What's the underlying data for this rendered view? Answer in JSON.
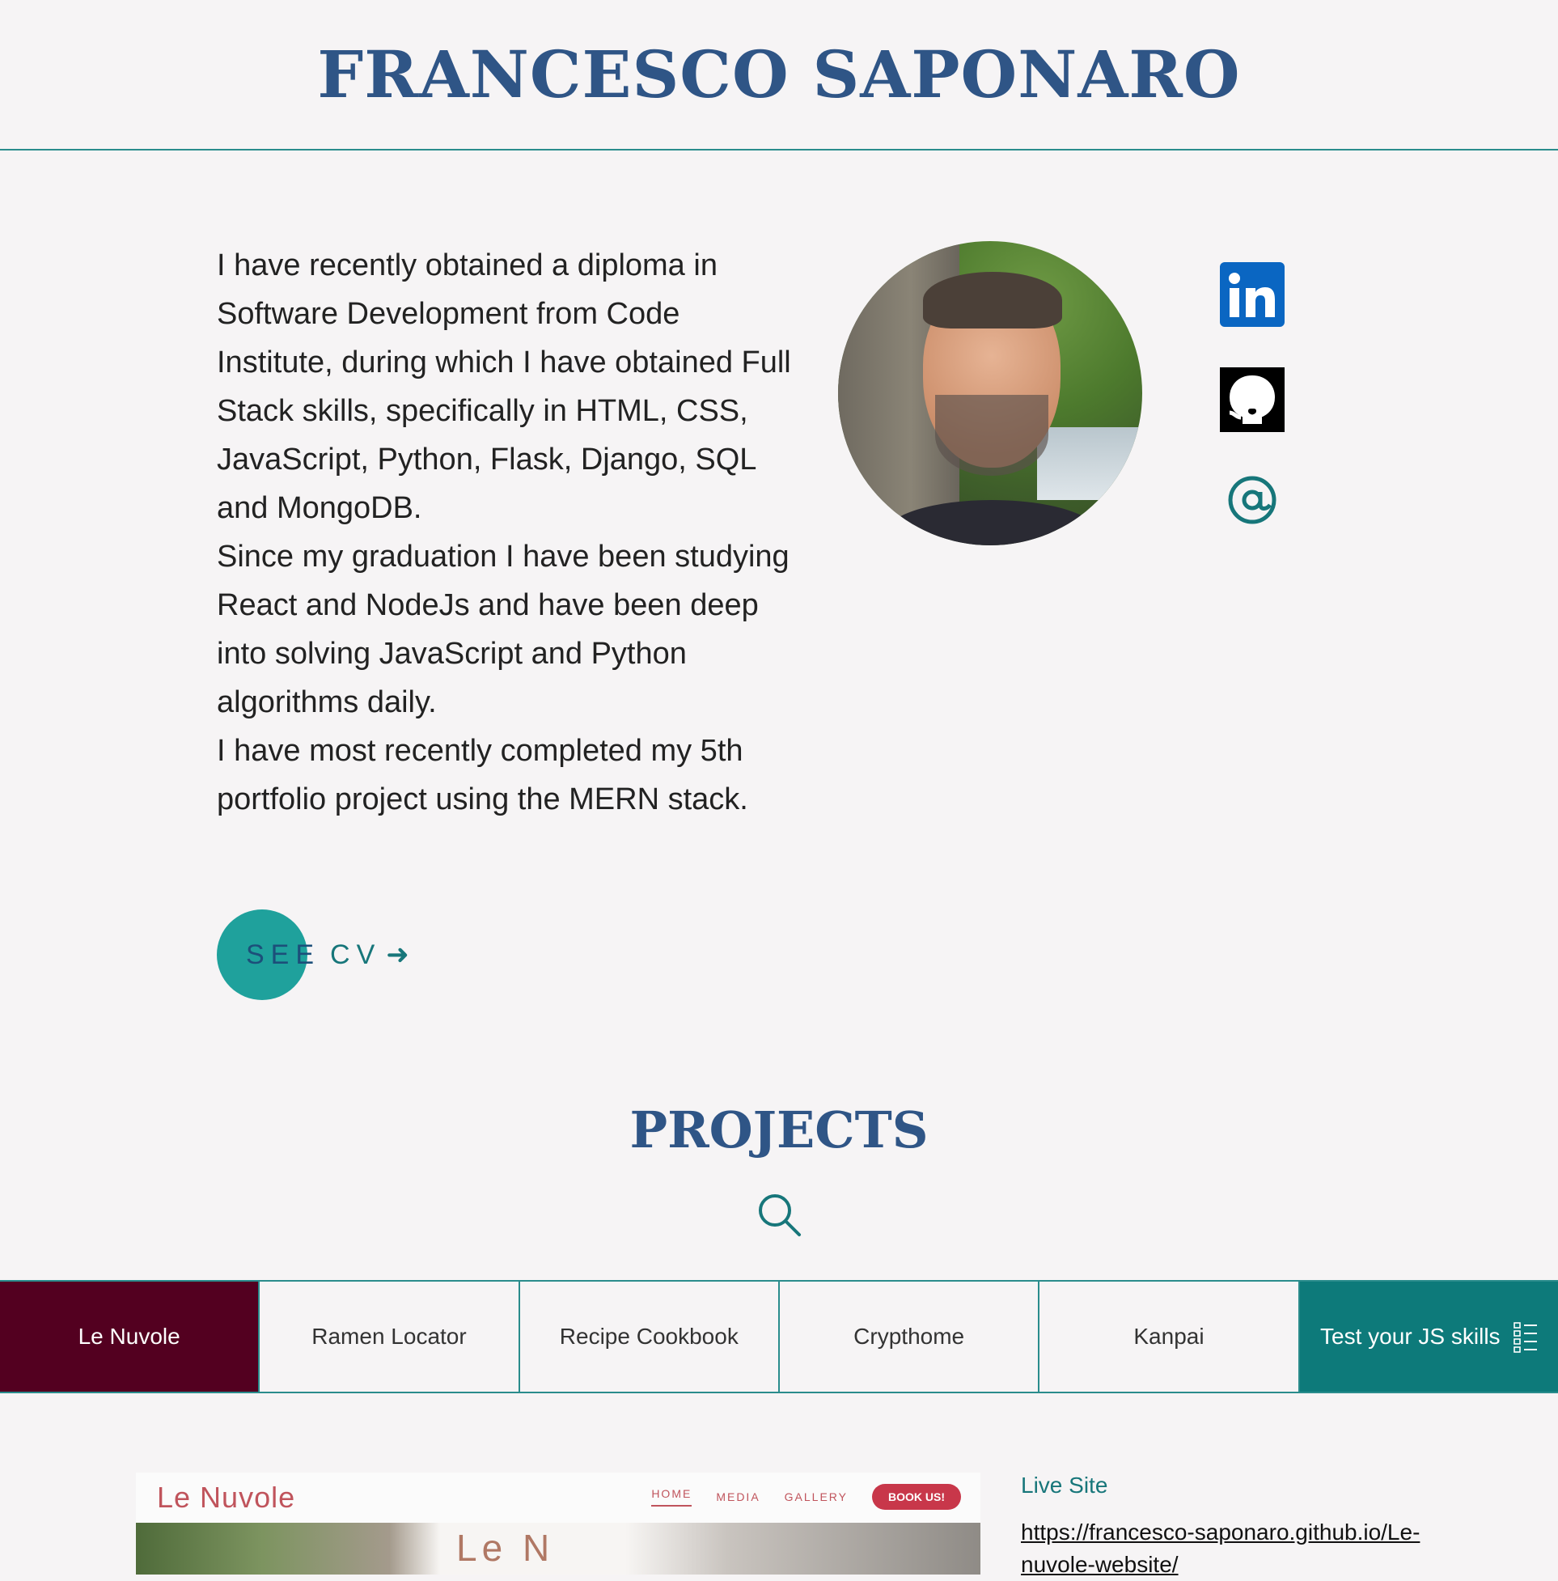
{
  "header": {
    "title": "FRANCESCO SAPONARO"
  },
  "about": {
    "paragraphs": [
      "I have recently obtained a diploma in Software Development from Code Institute, during which I have obtained Full Stack skills, specifically in HTML, CSS, JavaScript, Python, Flask, Django, SQL and MongoDB.",
      "Since my graduation I have been studying React and NodeJs and have been deep into solving JavaScript and Python algorithms daily.",
      "I have most recently completed my 5th portfolio project using the MERN stack."
    ],
    "cv_button": {
      "see": "SEE",
      "cv": "CV",
      "arrow": "➜"
    }
  },
  "social": {
    "linkedin": {
      "icon": "linkedin-icon",
      "color": "#0a66c2"
    },
    "github": {
      "icon": "github-icon",
      "color": "#000000"
    },
    "email": {
      "icon": "at-sign-icon",
      "color": "#17767a"
    }
  },
  "projects": {
    "title": "PROJECTS",
    "search_icon": "search-icon",
    "tabs": [
      {
        "label": "Le Nuvole",
        "active": true
      },
      {
        "label": "Ramen Locator"
      },
      {
        "label": "Recipe Cookbook"
      },
      {
        "label": "Crypthome"
      },
      {
        "label": "Kanpai"
      },
      {
        "label": "Test your JS skills",
        "icon": "checklist-icon"
      }
    ],
    "selected": {
      "preview": {
        "brand": "Le Nuvole",
        "nav": [
          "HOME",
          "MEDIA",
          "GALLERY"
        ],
        "cta": "BOOK US!",
        "hero_text": "Le N"
      },
      "live_label": "Live Site",
      "live_url": "https://francesco-saponaro.github.io/Le-nuvole-website/"
    }
  },
  "colors": {
    "primary_blue": "#2f5586",
    "teal": "#17767a",
    "active_tab": "#530020",
    "js_tab": "#0d7a7a",
    "background": "#f6f4f5"
  }
}
